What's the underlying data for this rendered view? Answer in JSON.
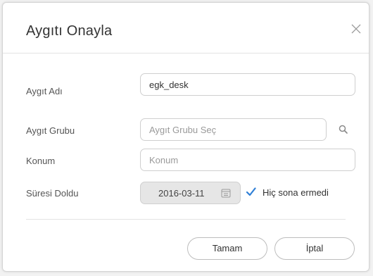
{
  "dialog": {
    "title": "Aygıtı Onayla"
  },
  "form": {
    "device_name": {
      "label": "Aygıt Adı",
      "value": "egk_desk"
    },
    "device_group": {
      "label": "Aygıt Grubu",
      "placeholder": "Aygıt Grubu Seç"
    },
    "location": {
      "label": "Konum",
      "placeholder": "Konum"
    },
    "expiry": {
      "label": "Süresi Doldu",
      "date": "2016-03-11",
      "never_expires_label": "Hiç sona ermedi",
      "never_expires_checked": true
    }
  },
  "buttons": {
    "ok_label": "Tamam",
    "cancel_label": "İptal"
  },
  "colors": {
    "accent": "#2f7fd6"
  },
  "icons": {
    "close": "close-icon",
    "search": "search-icon",
    "calendar": "calendar-icon",
    "check": "checkmark-icon"
  }
}
